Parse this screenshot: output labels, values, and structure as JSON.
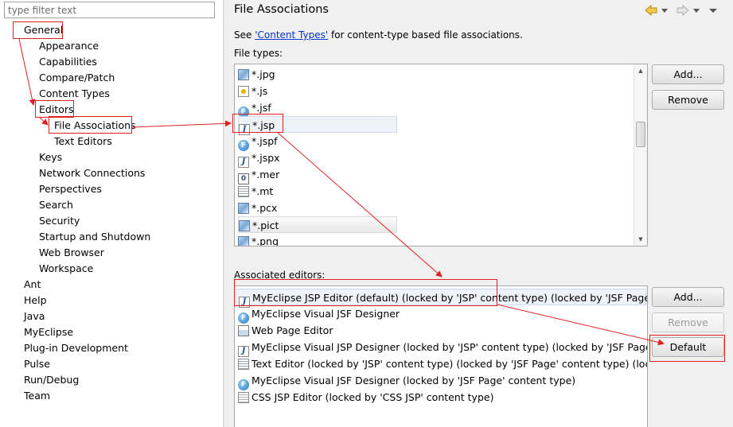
{
  "filter": {
    "placeholder": "type filter text"
  },
  "tree": {
    "general": "General",
    "appearance": "Appearance",
    "capabilities": "Capabilities",
    "compare_patch": "Compare/Patch",
    "content_types": "Content Types",
    "editors": "Editors",
    "file_associations": "File Associations",
    "text_editors": "Text Editors",
    "keys": "Keys",
    "network_connections": "Network Connections",
    "perspectives": "Perspectives",
    "search": "Search",
    "security": "Security",
    "startup_shutdown": "Startup and Shutdown",
    "web_browser": "Web Browser",
    "workspace": "Workspace",
    "ant": "Ant",
    "help": "Help",
    "java": "Java",
    "myeclipse": "MyEclipse",
    "plugin_development": "Plug-in Development",
    "pulse": "Pulse",
    "run_debug": "Run/Debug",
    "team": "Team"
  },
  "page": {
    "title": "File Associations",
    "see_prefix": "See ",
    "see_link": "'Content Types'",
    "see_suffix": " for content-type based file associations.",
    "file_types_label": "File types:",
    "associated_editors_label": "Associated editors:"
  },
  "file_types": [
    {
      "label": "*.jpg",
      "icon": "image-icon"
    },
    {
      "label": "*.js",
      "icon": "javascript-file-icon"
    },
    {
      "label": "*.jsf",
      "icon": "jsf-icon"
    },
    {
      "label": "*.jsp",
      "icon": "jsp-icon"
    },
    {
      "label": "*.jspf",
      "icon": "jsf-icon"
    },
    {
      "label": "*.jspx",
      "icon": "jsp-icon"
    },
    {
      "label": "*.mer",
      "icon": "mer-icon"
    },
    {
      "label": "*.mt",
      "icon": "text-file-icon"
    },
    {
      "label": "*.pcx",
      "icon": "image-icon"
    },
    {
      "label": "*.pict",
      "icon": "image-icon"
    },
    {
      "label": "*.png",
      "icon": "image-icon"
    }
  ],
  "editors": [
    {
      "label": "MyEclipse JSP Editor (default) (locked by 'JSP' content type) (locked by 'JSF Page' con",
      "icon": "jsp-icon"
    },
    {
      "label": "MyEclipse Visual JSF Designer",
      "icon": "jsf-icon"
    },
    {
      "label": "Web Page Editor",
      "icon": "web-page-icon"
    },
    {
      "label": "MyEclipse Visual JSP Designer (locked by 'JSP' content type) (locked by 'JSF Page' co",
      "icon": "jsp-icon"
    },
    {
      "label": "Text Editor (locked by 'JSP' content type) (locked by 'JSF Page' content type) (locked",
      "icon": "text-file-icon"
    },
    {
      "label": "MyEclipse Visual JSF Designer (locked by 'JSF Page' content type)",
      "icon": "jsf-icon"
    },
    {
      "label": "CSS JSP Editor (locked by 'CSS JSP' content type)",
      "icon": "css-file-icon"
    }
  ],
  "buttons": {
    "add_filetype": "Add...",
    "remove_filetype": "Remove",
    "add_editor": "Add...",
    "remove_editor": "Remove",
    "default_editor": "Default"
  },
  "colors": {
    "annotation": "#e02020",
    "link": "#0033cc"
  }
}
